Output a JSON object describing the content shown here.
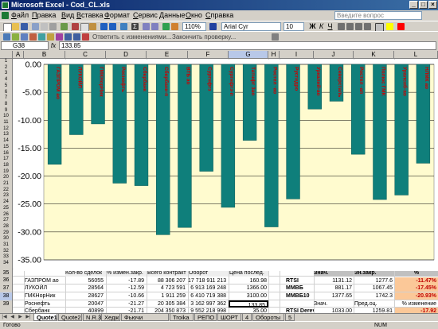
{
  "window": {
    "title": "Microsoft Excel - Cod_CL.xls"
  },
  "menu": {
    "items": [
      "Файл",
      "Правка",
      "Вид",
      "Вставка",
      "Формат",
      "Сервис",
      "Данные",
      "Окно",
      "Справка"
    ],
    "ask_placeholder": "Введите вопрос"
  },
  "toolbar": {
    "zoom": "110%",
    "font": "Arial Cyr",
    "font_size": "10",
    "reply_text": "Ответить с изменениями...",
    "end_review_text": "Закончить проверку..."
  },
  "formula_bar": {
    "cell_ref": "G38",
    "fx": "fx",
    "value": "133.85"
  },
  "columns": [
    "A",
    "B",
    "C",
    "D",
    "E",
    "F",
    "G",
    "H",
    "I",
    "J",
    "K",
    "L"
  ],
  "rows": [
    "1",
    "2",
    "3",
    "4",
    "5",
    "6",
    "7",
    "8",
    "9",
    "10",
    "11",
    "12",
    "13",
    "14",
    "15",
    "16",
    "17",
    "18",
    "19",
    "20",
    "21",
    "22",
    "23",
    "24",
    "25",
    "26",
    "27",
    "28",
    "29",
    "30",
    "31",
    "32",
    "33",
    "34",
    "35",
    "36",
    "37",
    "38",
    "39"
  ],
  "chart_data": {
    "type": "bar",
    "categories": [
      "ГАЗПРОМ ао",
      "ЛУКОЙЛ",
      "ГМКНорНик",
      "Роснефть",
      "Сбербанк",
      "Сбербанк-п",
      "ВТБ ао",
      "Сургнфгз",
      "Сургнфгз-п",
      "Татнфт 3ао",
      "Ростел -ао",
      "Русгидро",
      "Уркалий-ао",
      "Северсталь",
      "Ростел -ап",
      "Полюс ГМК",
      "Уралсиб-ао",
      "НЛМК ао"
    ],
    "values": [
      -17.89,
      -12.59,
      -10.66,
      -21.27,
      -21.71,
      -30.5,
      -29.2,
      -19.14,
      -25.6,
      -13.6,
      -29.1,
      -24.1,
      -8.0,
      -6.6,
      -16.1,
      -24.2,
      -23.4,
      -17.7
    ],
    "ylim": [
      -35,
      0
    ],
    "yticks": [
      "0.00",
      "-5.00",
      "-10.00",
      "-15.00",
      "-20.00",
      "-25.00",
      "-30.00",
      "-35.00"
    ],
    "grid": true,
    "colors": {
      "bar": "#0f7f7b",
      "label": "#cc0000",
      "plot_bg": "#fffbcf"
    }
  },
  "table": {
    "headers": [
      "Кол-во сделок",
      "% измен.закр.",
      "Всего контракт",
      "Оборот",
      "Цена послед."
    ],
    "rows": [
      {
        "name": "ГАЗПРОМ ао",
        "deals": "56055",
        "pct": "-17.89",
        "contracts": "88 306 207",
        "turnover": "17 718 911 213",
        "price": "160.98"
      },
      {
        "name": "ЛУКОЙЛ",
        "deals": "28564",
        "pct": "-12.59",
        "contracts": "4 723 591",
        "turnover": "6 913 169 248",
        "price": "1366.00"
      },
      {
        "name": "ГМКНорНик",
        "deals": "28627",
        "pct": "-10.66",
        "contracts": "1 911 259",
        "turnover": "6 410 719 388",
        "price": "3100.00"
      },
      {
        "name": "Роснефть",
        "deals": "20047",
        "pct": "-21.27",
        "contracts": "20 305 384",
        "turnover": "3 162 997 362",
        "price": "133.85"
      },
      {
        "name": "Сбербанк",
        "deals": "40899",
        "pct": "-21.71",
        "contracts": "204 350 873",
        "turnover": "9 552 218 998",
        "price": "35.00"
      }
    ],
    "index_headers": [
      "Знач.",
      "Зн.закр.",
      "%"
    ],
    "index_rows": [
      {
        "name": "RTSI",
        "value": "1131.12",
        "close": "1277.6",
        "pct": "-11.47%"
      },
      {
        "name": "ММВБ",
        "value": "881.17",
        "close": "1067.45",
        "pct": "-17.45%"
      },
      {
        "name": "ММВБ10",
        "value": "1377.65",
        "close": "1742.3",
        "pct": "-20.93%"
      },
      {
        "name": "",
        "value": "Знач.",
        "close": "Пред.оц.",
        "pct": "% изменение"
      },
      {
        "name": "RTSI Derev",
        "value": "1033.00",
        "close": "1259.81",
        "pct": "-17.92"
      }
    ]
  },
  "sheet_tabs": [
    "Quote1",
    "Quote2",
    "N.R.3",
    "Хедж",
    "Фьючи КОНТРОЛЬ",
    "Troika",
    "РЕПО",
    "ШОРТ",
    "4",
    "Обороты",
    "5"
  ],
  "status": {
    "left": "Готово",
    "right": "NUM"
  }
}
